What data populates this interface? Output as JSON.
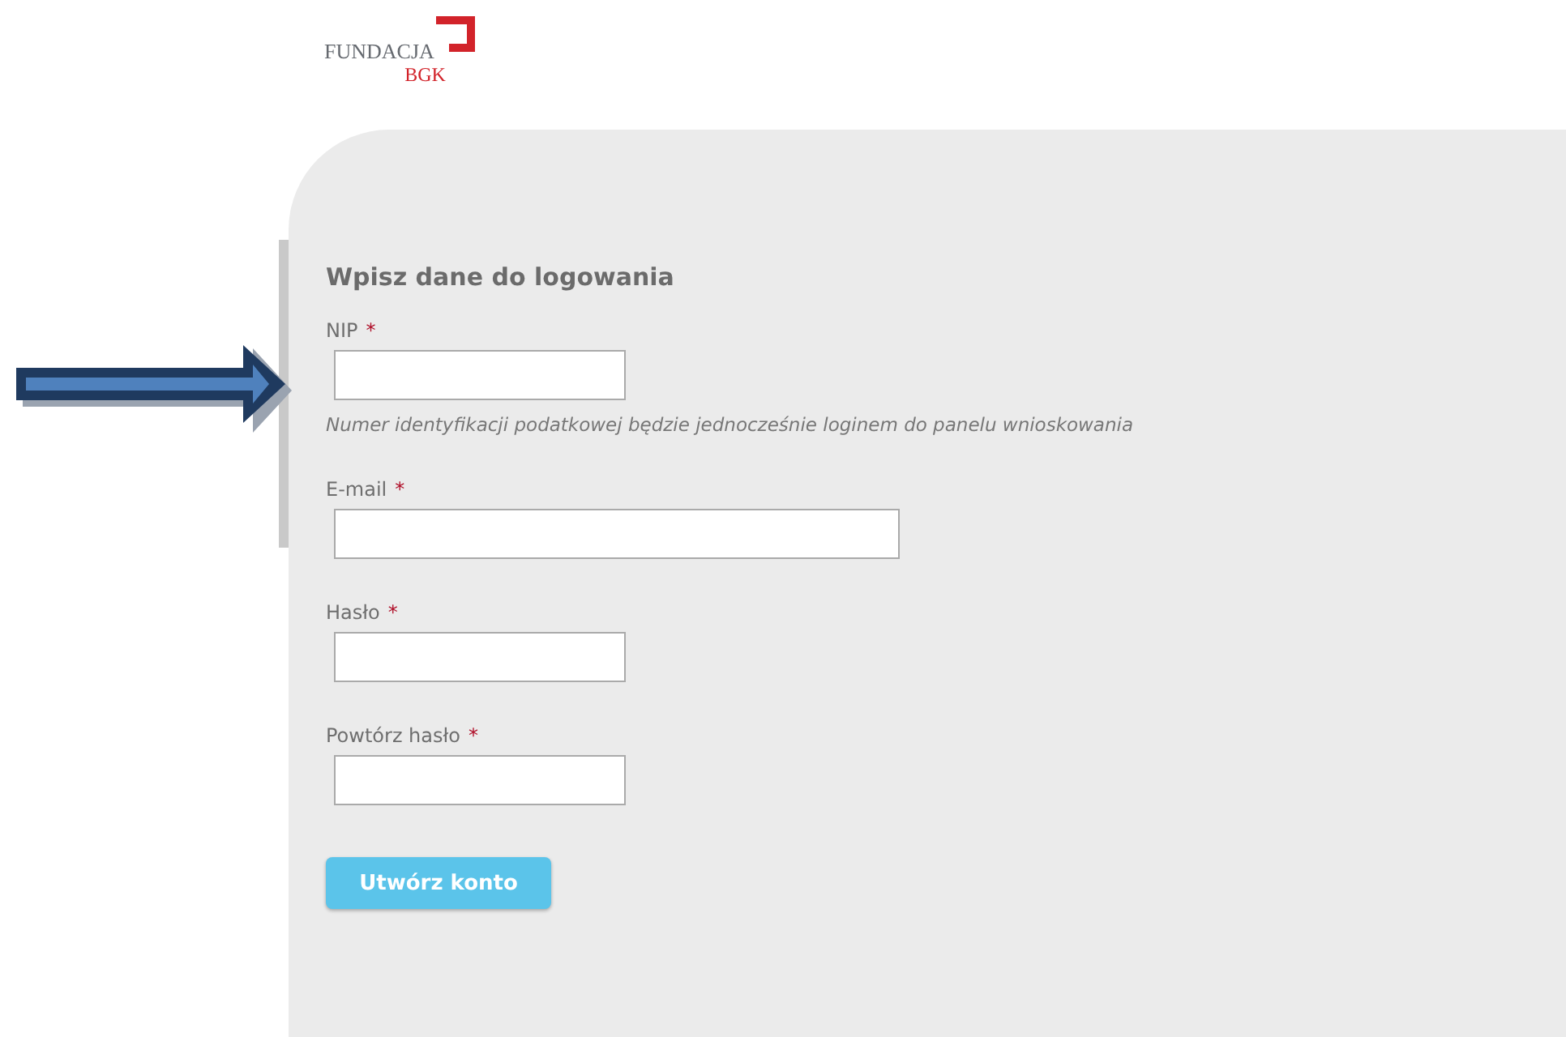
{
  "logo": {
    "name": "FUNDACJA",
    "subname": "BGK"
  },
  "form": {
    "title": "Wpisz dane do logowania",
    "fields": [
      {
        "label": "NIP",
        "mark": "*",
        "kind": "short",
        "hint": "Numer identyfikacji podatkowej będzie jednocześnie loginem do panelu wnioskowania"
      },
      {
        "label": "E-mail",
        "mark": "*",
        "kind": "long"
      },
      {
        "label": "Hasło",
        "mark": "*",
        "kind": "short"
      },
      {
        "label": "Powtórz hasło",
        "mark": "*",
        "kind": "short"
      }
    ],
    "button": "Utwórz konto"
  }
}
